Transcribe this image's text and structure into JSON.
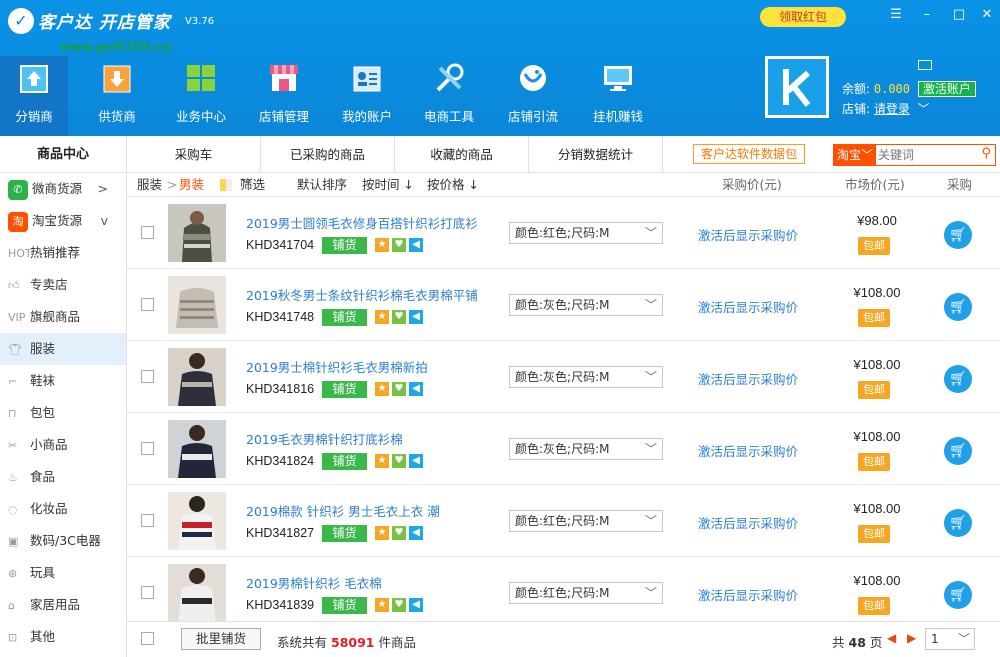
{
  "header": {
    "title": "客户达 开店管家",
    "version": "V3.76",
    "watermark": "www.pc0359.cn",
    "red_packet": "领取红包",
    "window_controls": [
      "menu-icon",
      "minimize-icon",
      "maximize-icon",
      "close-icon"
    ]
  },
  "nav": [
    {
      "label": "分销商",
      "icon": "upload-box-icon",
      "active": true
    },
    {
      "label": "供货商",
      "icon": "download-box-icon"
    },
    {
      "label": "业务中心",
      "icon": "grid-icon"
    },
    {
      "label": "店铺管理",
      "icon": "store-icon"
    },
    {
      "label": "我的账户",
      "icon": "id-card-icon"
    },
    {
      "label": "电商工具",
      "icon": "tools-icon"
    },
    {
      "label": "店铺引流",
      "icon": "traffic-icon"
    },
    {
      "label": "挂机赚钱",
      "icon": "monitor-icon"
    }
  ],
  "account": {
    "balance_label": "余额:",
    "balance_value": "0.000",
    "activate": "激活账户",
    "store_label": "店铺:",
    "store_value": "请登录"
  },
  "sidebar": {
    "header": "商品中心",
    "items": [
      {
        "label": "微商货源",
        "icon": "wechat-icon",
        "chevron": ">"
      },
      {
        "label": "淘宝货源",
        "icon": "taobao-icon",
        "chevron": "v"
      },
      {
        "label": "热销推荐",
        "icon": "hot-icon",
        "prefix": "HOT"
      },
      {
        "label": "专卖店",
        "icon": "thumbs-up-icon"
      },
      {
        "label": "旗舰商品",
        "icon": "vip-icon",
        "prefix": "VIP"
      },
      {
        "label": "服装",
        "icon": "shirt-icon",
        "active": true
      },
      {
        "label": "鞋袜",
        "icon": "shoe-icon"
      },
      {
        "label": "包包",
        "icon": "bag-icon"
      },
      {
        "label": "小商品",
        "icon": "scissors-icon"
      },
      {
        "label": "食品",
        "icon": "food-icon"
      },
      {
        "label": "化妆品",
        "icon": "cosmetics-icon"
      },
      {
        "label": "数码/3C电器",
        "icon": "digital-icon"
      },
      {
        "label": "玩具",
        "icon": "toy-icon"
      },
      {
        "label": "家居用品",
        "icon": "home-icon"
      },
      {
        "label": "其他",
        "icon": "other-icon"
      }
    ]
  },
  "tabs": [
    "采购车",
    "已采购的商品",
    "收藏的商品",
    "分销数据统计"
  ],
  "data_pack_button": "客户达软件数据包",
  "search": {
    "platform": "淘宝",
    "placeholder": "关键词"
  },
  "filter": {
    "crumb_root": "服装",
    "crumb_sep": ">",
    "crumb_current": "男装",
    "filter_label": "筛选",
    "sort_default": "默认排序",
    "sort_time": "按时间 ↓",
    "sort_price": "按价格 ↓",
    "col_purchase_price": "采购价(元)",
    "col_market_price": "市场价(元)",
    "col_buy": "采购"
  },
  "products": [
    {
      "title": "2019男士圆领毛衣修身百搭针织衫打底衫",
      "code": "KHD341704",
      "option": "颜色:红色;尺码:M",
      "market_price": "¥98.00"
    },
    {
      "title": "2019秋冬男士条纹针织衫棉毛衣男棉平铺",
      "code": "KHD341748",
      "option": "颜色:灰色;尺码:M",
      "market_price": "¥108.00"
    },
    {
      "title": "2019男士棉针织衫毛衣男棉新拍",
      "code": "KHD341816",
      "option": "颜色:灰色;尺码:M",
      "market_price": "¥108.00"
    },
    {
      "title": "2019毛衣男棉针织打底衫棉",
      "code": "KHD341824",
      "option": "颜色:灰色;尺码:M",
      "market_price": "¥108.00"
    },
    {
      "title": "2019棉款 针织衫 男士毛衣上衣 潮",
      "code": "KHD341827",
      "option": "颜色:红色;尺码:M",
      "market_price": "¥108.00"
    },
    {
      "title": "2019男棉针织衫 毛衣棉",
      "code": "KHD341839",
      "option": "颜色:红色;尺码:M",
      "market_price": "¥108.00"
    }
  ],
  "product_common": {
    "restock": "铺货",
    "purchase_price_hint": "激活后显示采购价",
    "free_shipping": "包邮"
  },
  "footer": {
    "bulk_button": "批里铺货",
    "total_prefix": "系统共有",
    "total_count": "58091",
    "total_suffix": "件商品",
    "pages_prefix": "共",
    "pages_count": "48",
    "pages_suffix": "页",
    "current_page": "1"
  }
}
